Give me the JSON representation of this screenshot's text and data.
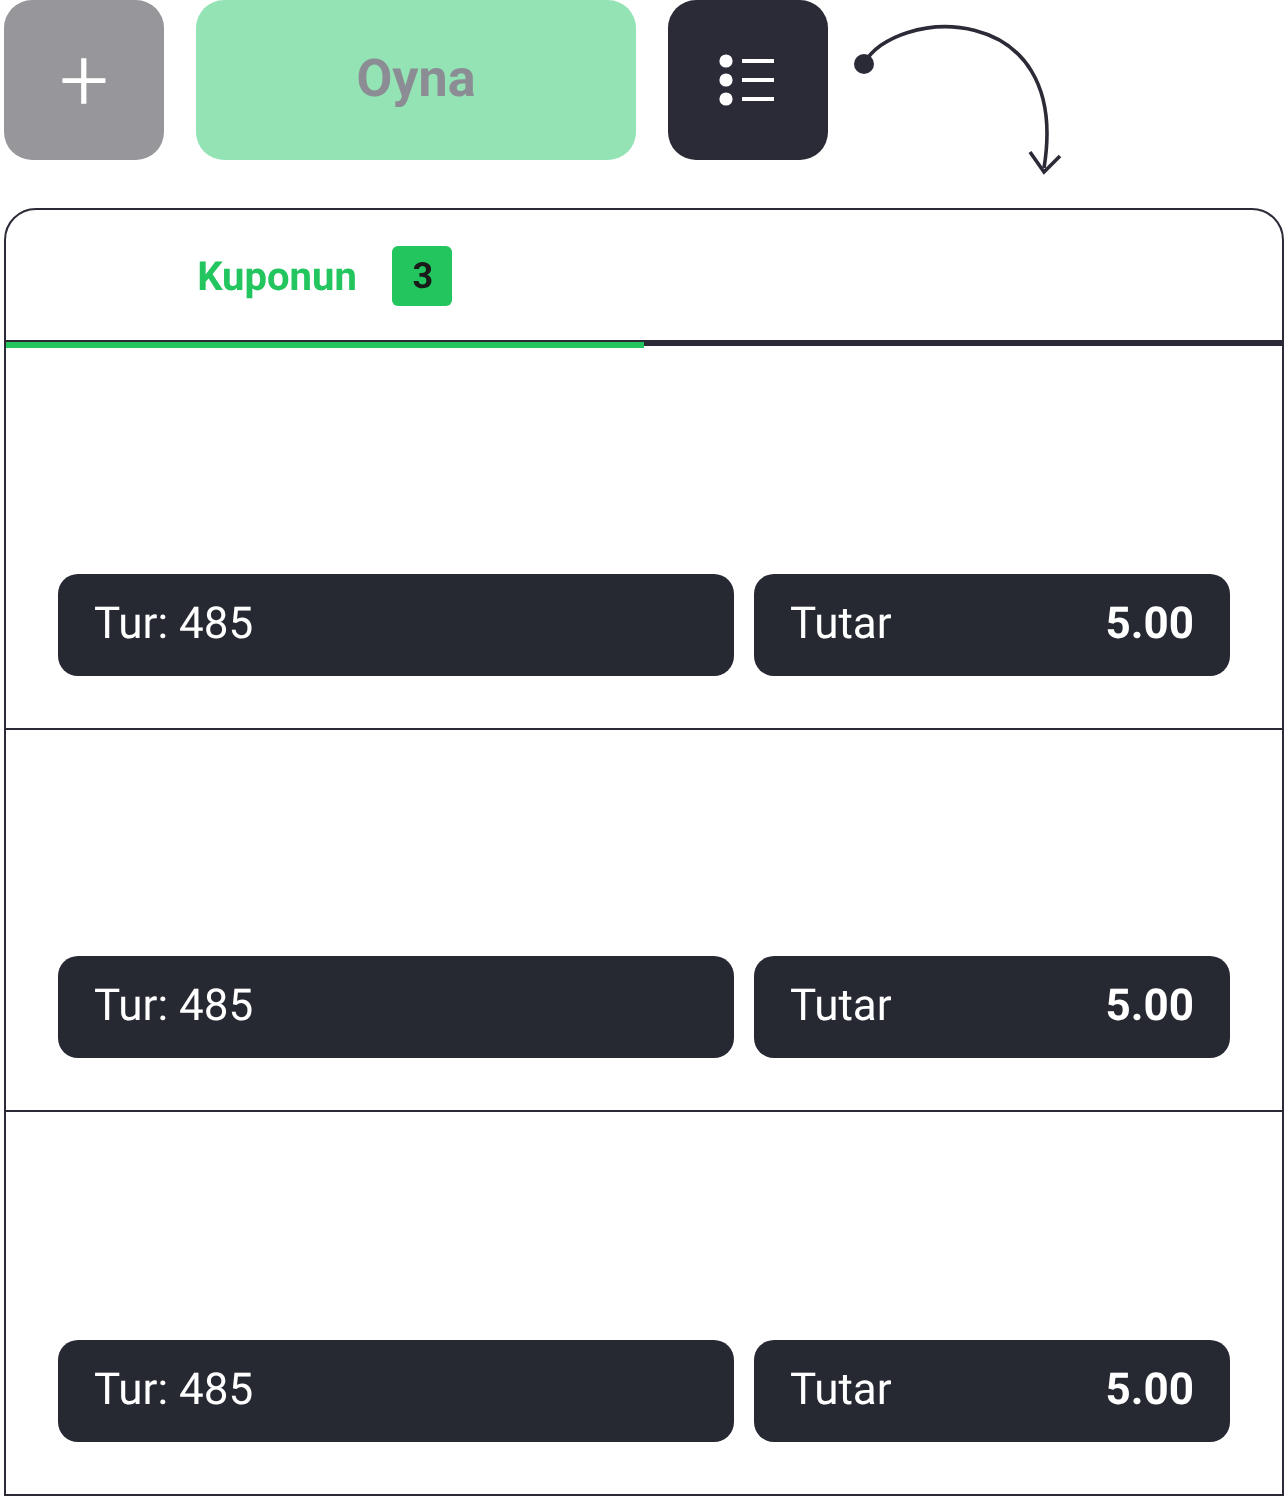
{
  "toolbar": {
    "add_button": {
      "label": "+"
    },
    "play_button": {
      "label": "Oyna",
      "disabled": true
    }
  },
  "tabs": [
    {
      "label": "Kuponun",
      "badge": "3",
      "selected": true
    }
  ],
  "coupons": [
    {
      "round": "Tur: 485",
      "amount_label": "Tutar",
      "amount": "5.00"
    },
    {
      "round": "Tur: 485",
      "amount_label": "Tutar",
      "amount": "5.00"
    },
    {
      "round": "Tur: 485",
      "amount_label": "Tutar",
      "amount": "5.00"
    }
  ]
}
